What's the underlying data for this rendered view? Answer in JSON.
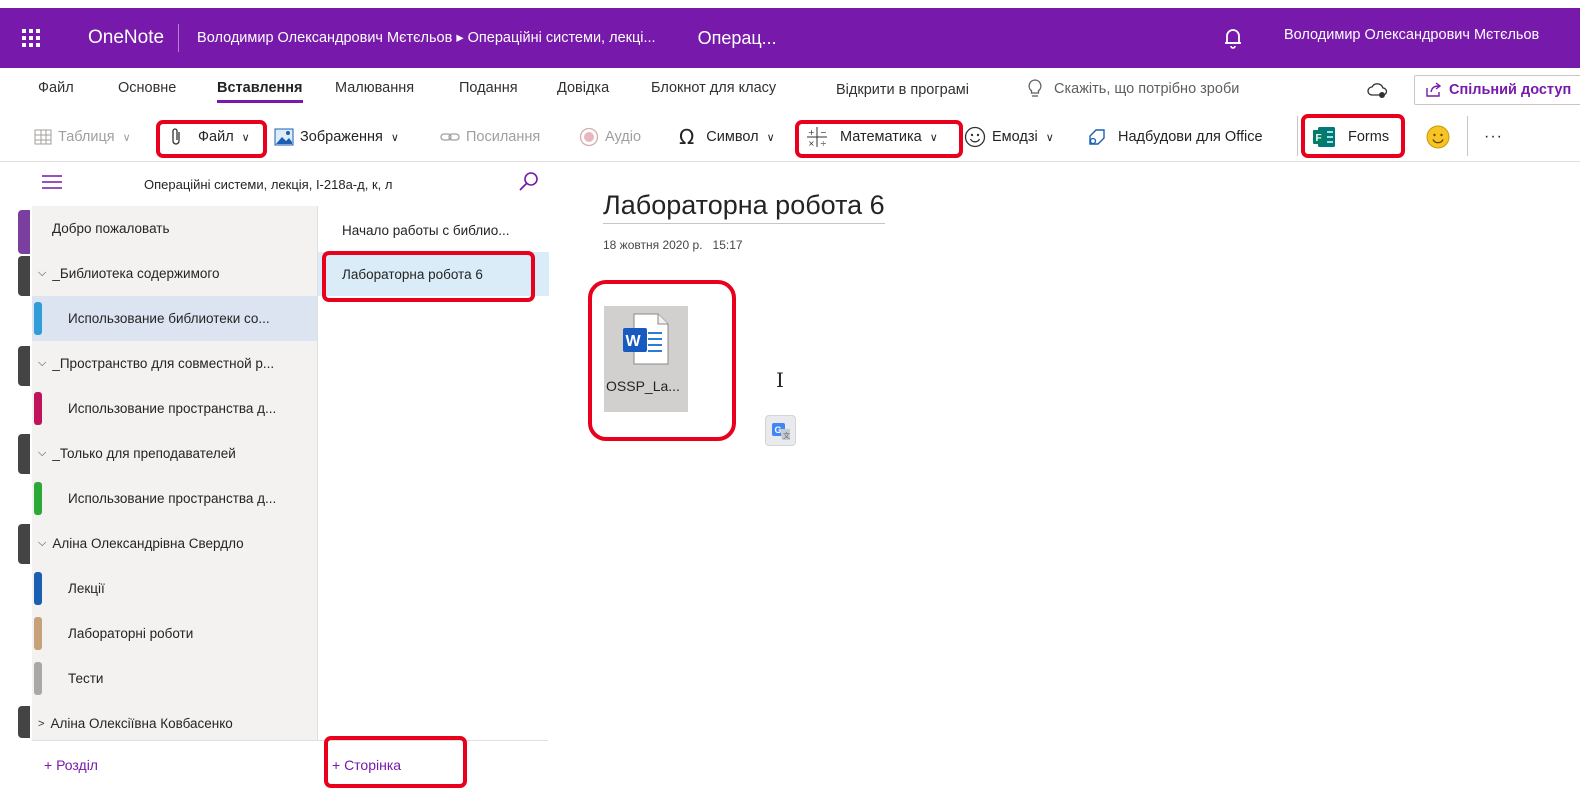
{
  "topbar": {
    "app_name": "OneNote",
    "breadcrumb": "Володимир Олександрович Мєтєльов ▸ Операційні системи, лекці...",
    "page_crumb": "Операц...",
    "user_name": "Володимир Олександрович Мєтєльов",
    "waffle_icon": "waffle-icon",
    "bell_icon": "bell-icon"
  },
  "ribbon": {
    "tabs": [
      "Файл",
      "Основне",
      "Вставлення",
      "Малювання",
      "Подання",
      "Довідка",
      "Блокнот для класу",
      "Відкрити в програмі"
    ],
    "active_tab": "Вставлення",
    "tell_me": "Скажіть, що потрібно зроби",
    "share_label": "Спільний доступ"
  },
  "toolbar": {
    "table": "Таблиця",
    "file": "Файл",
    "image": "Зображення",
    "link": "Посилання",
    "audio": "Аудіо",
    "symbol": "Символ",
    "math": "Математика",
    "emoji": "Емодзі",
    "addins": "Надбудови для Office",
    "forms": "Forms",
    "more": "···"
  },
  "nav": {
    "notebook_title": "Операційні системи, лекція, І-218а-д, к, л",
    "sections": [
      {
        "label": "Добро пожаловать",
        "kind": "item0"
      },
      {
        "label": "_Библиотека содержимого",
        "kind": "group",
        "chevron": "⌵"
      },
      {
        "label": "Использование библиотеки со...",
        "kind": "item",
        "color": "#2f9ed8"
      },
      {
        "label": "_Пространство для совместной р...",
        "kind": "group",
        "chevron": "⌵"
      },
      {
        "label": "Использование пространства д...",
        "kind": "item",
        "color": "#c0135a"
      },
      {
        "label": "_Только для преподавателей",
        "kind": "group",
        "chevron": "⌵"
      },
      {
        "label": "Использование пространства д...",
        "kind": "item",
        "color": "#2aa838"
      },
      {
        "label": "Аліна Олександрівна Свердло",
        "kind": "group",
        "chevron": "⌵"
      },
      {
        "label": "Лекції",
        "kind": "item",
        "color": "#1b5fb3"
      },
      {
        "label": "Лабораторні роботи",
        "kind": "item",
        "color": "#c5a27a"
      },
      {
        "label": "Тести",
        "kind": "item",
        "color": "#a8a8a8"
      },
      {
        "label": "Аліна Олексіївна Ковбасенко",
        "kind": "group",
        "chevron": ">"
      }
    ],
    "pages": [
      "Начало работы с библио...",
      "Лабораторна робота 6"
    ],
    "add_section": "+ Розділ",
    "add_page": "+ Сторінка"
  },
  "content": {
    "title": "Лабораторна робота 6",
    "date": "18 жовтня 2020 р.",
    "time": "15:17",
    "attachment_name": "OSSP_La...",
    "attachment_icon": "word-file-icon"
  },
  "colors": {
    "brand": "#7719aa",
    "highlight": "#e8001c"
  }
}
